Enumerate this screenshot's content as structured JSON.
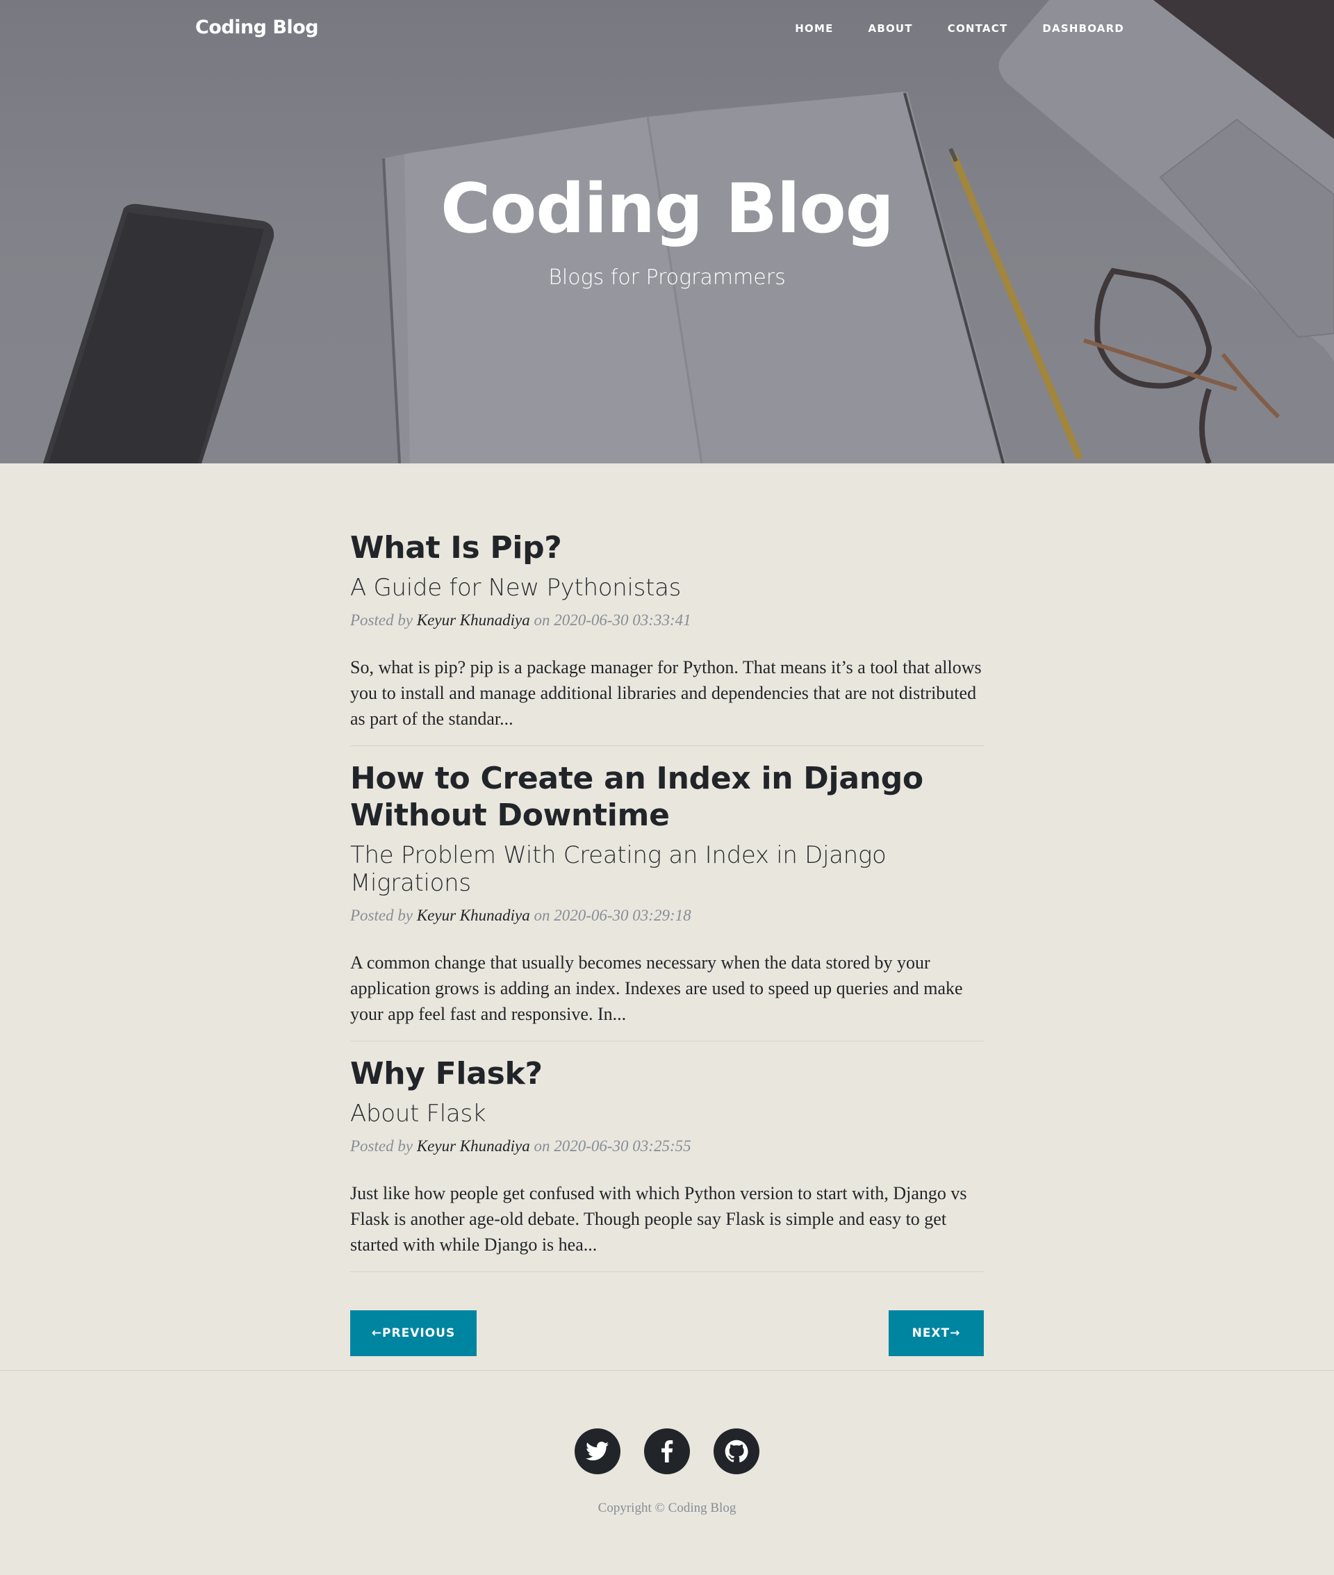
{
  "nav": {
    "brand": "Coding Blog",
    "links": [
      "HOME",
      "ABOUT",
      "CONTACT",
      "DASHBOARD"
    ]
  },
  "hero": {
    "title": "Coding Blog",
    "subtitle": "Blogs for Programmers"
  },
  "posts": [
    {
      "title": "What Is Pip?",
      "subtitle": "A Guide for New Pythonistas",
      "posted_by": "Posted by",
      "author": "Keyur Khunadiya",
      "on": "on",
      "date": "2020-06-30 03:33:41",
      "excerpt": "So, what is pip? pip is a package manager for Python. That means it’s a tool that allows you to install and manage additional libraries and dependencies that are not distributed as part of the standar..."
    },
    {
      "title": "How to Create an Index in Django Without Downtime",
      "subtitle": "The Problem With Creating an Index in Django Migrations",
      "posted_by": "Posted by",
      "author": "Keyur Khunadiya",
      "on": "on",
      "date": "2020-06-30 03:29:18",
      "excerpt": "A common change that usually becomes necessary when the data stored by your application grows is adding an index. Indexes are used to speed up queries and make your app feel fast and responsive. In..."
    },
    {
      "title": "Why Flask?",
      "subtitle": "About Flask",
      "posted_by": "Posted by",
      "author": "Keyur Khunadiya",
      "on": "on",
      "date": "2020-06-30 03:25:55",
      "excerpt": "Just like how people get confused with which Python version to start with, Django vs Flask is another age-old debate. Though people say Flask is simple and easy to get started with while Django is hea..."
    }
  ],
  "pager": {
    "previous": "←PREVIOUS",
    "next": "NEXT→"
  },
  "footer": {
    "social_icons": [
      "twitter-icon",
      "facebook-icon",
      "github-icon"
    ],
    "copyright": "Copyright © Coding Blog"
  },
  "colors": {
    "background": "#e9e6dd",
    "accent": "#0085a1",
    "text": "#212529",
    "muted": "#868e96"
  }
}
